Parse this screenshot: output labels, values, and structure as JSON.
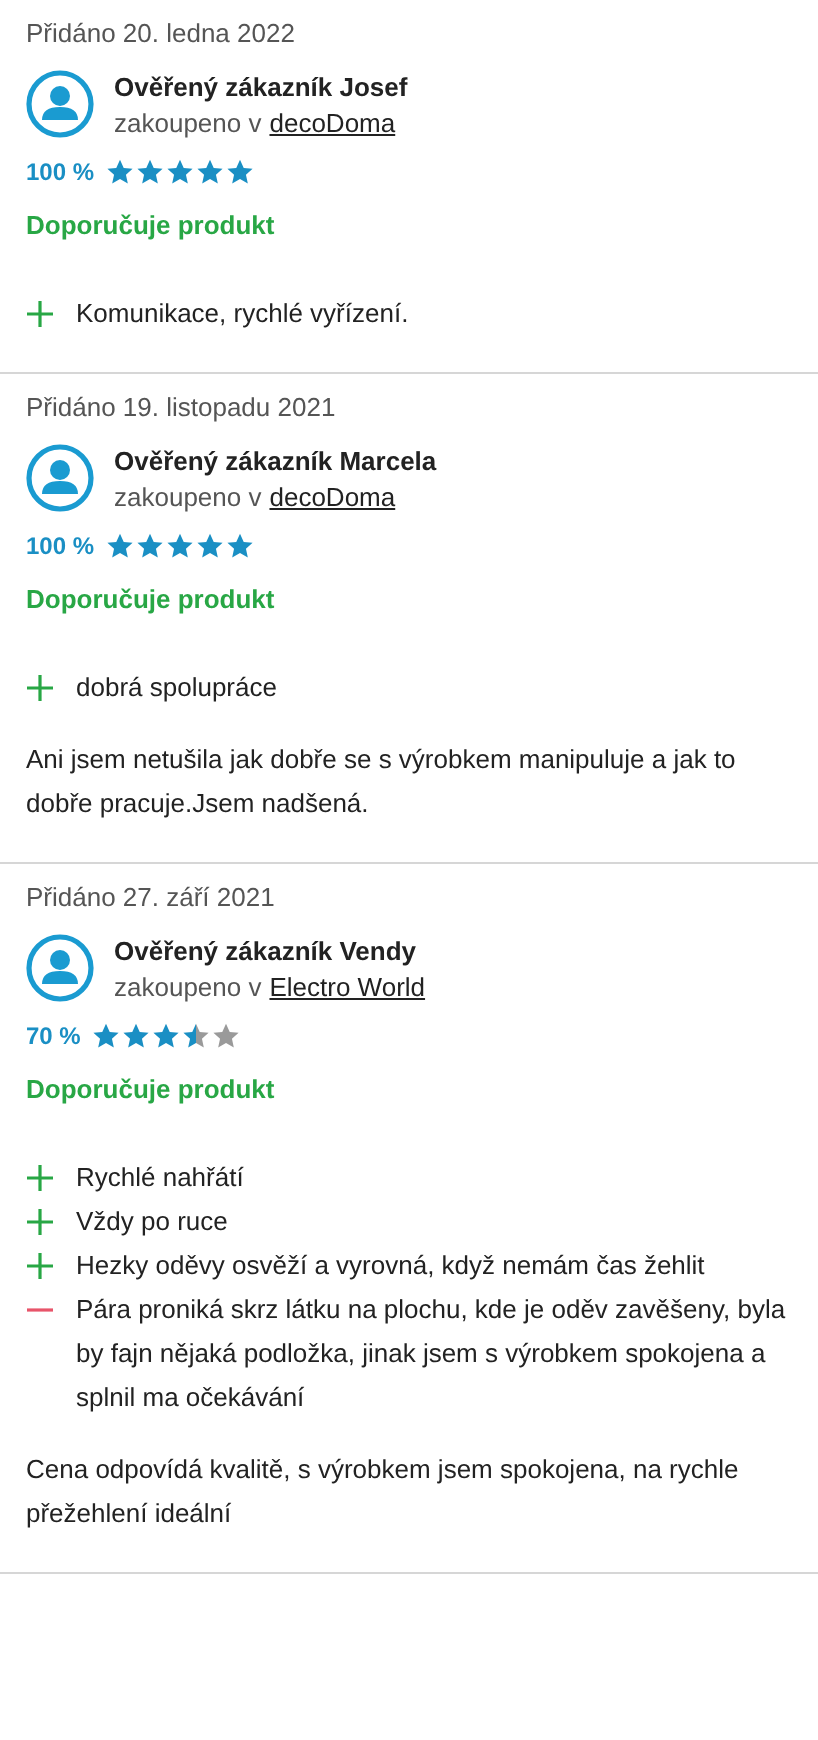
{
  "reviews": [
    {
      "date": "Přidáno 20. ledna 2022",
      "author": "Ověřený zákazník Josef",
      "shop_prefix": "zakoupeno v",
      "shop": "decoDoma",
      "percent": "100 %",
      "stars": 5,
      "recommend": "Doporučuje produkt",
      "points": [
        {
          "kind": "pro",
          "text": "Komunikace, rychlé vyřízení."
        }
      ]
    },
    {
      "date": "Přidáno 19. listopadu 2021",
      "author": "Ověřený zákazník Marcela",
      "shop_prefix": "zakoupeno v",
      "shop": "decoDoma",
      "percent": "100 %",
      "stars": 5,
      "recommend": "Doporučuje produkt",
      "points": [
        {
          "kind": "pro",
          "text": "dobrá spolupráce"
        }
      ],
      "comment": "Ani jsem netušila jak dobře se s výrobkem manipuluje a jak to dobře pracuje.Jsem nadšená."
    },
    {
      "date": "Přidáno 27. září 2021",
      "author": "Ověřený zákazník Vendy",
      "shop_prefix": "zakoupeno v",
      "shop": "Electro World",
      "percent": "70 %",
      "stars": 3.5,
      "recommend": "Doporučuje produkt",
      "points": [
        {
          "kind": "pro",
          "text": "Rychlé nahřátí"
        },
        {
          "kind": "pro",
          "text": "Vždy po ruce"
        },
        {
          "kind": "pro",
          "text": "Hezky oděvy osvěží a vyrovná, když nemám čas žehlit"
        },
        {
          "kind": "con",
          "text": "Pára proniká skrz látku na plochu, kde je oděv zavěšeny, byla by fajn nějaká podložka, jinak jsem s výrobkem spokojena a splnil ma očekávání"
        }
      ],
      "comment": "Cena odpovídá kvalitě, s výrobkem jsem spokojena, na rychle přežehlení ideální"
    }
  ]
}
